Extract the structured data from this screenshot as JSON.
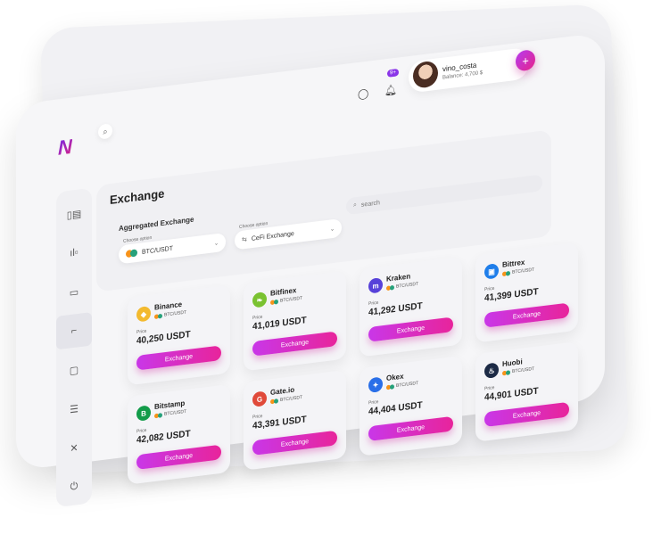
{
  "app": {
    "logo": "N"
  },
  "topbar": {
    "notifications_badge": "9+",
    "username": "vino_costa",
    "balance": "Balance: 4,700 $",
    "search_icon": "search-icon"
  },
  "sidebar": {
    "icons": [
      "dashboard-icon",
      "chart-icon",
      "wallet-icon",
      "exchange-icon",
      "window-icon",
      "list-icon",
      "tools-icon",
      "power-icon"
    ]
  },
  "exchange": {
    "title": "Exchange",
    "aggregated_title": "Aggregated Exchange",
    "pair_label": "Choose option",
    "pair_value": "BTC/USDT",
    "type_label": "Choose option",
    "type_value": "CeFi Exchange",
    "search_placeholder": "search"
  },
  "cards": [
    {
      "name": "Binance",
      "pair": "BTC/USDT",
      "price_label": "Price",
      "price": "40,250 USDT",
      "button": "Exchange",
      "color": "#f3ba2f",
      "glyph": "◆"
    },
    {
      "name": "Bitfinex",
      "pair": "BTC/USDT",
      "price_label": "Price",
      "price": "41,019 USDT",
      "button": "Exchange",
      "color": "#7ac231",
      "glyph": "❧"
    },
    {
      "name": "Kraken",
      "pair": "BTC/USDT",
      "price_label": "Price",
      "price": "41,292 USDT",
      "button": "Exchange",
      "color": "#5741d9",
      "glyph": "m"
    },
    {
      "name": "Bittrex",
      "pair": "BTC/USDT",
      "price_label": "Price",
      "price": "41,399 USDT",
      "button": "Exchange",
      "color": "#1f7eea",
      "glyph": "▣"
    },
    {
      "name": "Bitstamp",
      "pair": "BTC/USDT",
      "price_label": "Price",
      "price": "42,082 USDT",
      "button": "Exchange",
      "color": "#139c4a",
      "glyph": "B"
    },
    {
      "name": "Gate.io",
      "pair": "BTC/USDT",
      "price_label": "Price",
      "price": "43,391 USDT",
      "button": "Exchange",
      "color": "#e04a3a",
      "glyph": "G"
    },
    {
      "name": "Okex",
      "pair": "BTC/USDT",
      "price_label": "Price",
      "price": "44,404 USDT",
      "button": "Exchange",
      "color": "#2a6fe8",
      "glyph": "✦"
    },
    {
      "name": "Huobi",
      "pair": "BTC/USDT",
      "price_label": "Price",
      "price": "44,901 USDT",
      "button": "Exchange",
      "color": "#1c2a45",
      "glyph": "♨"
    }
  ]
}
